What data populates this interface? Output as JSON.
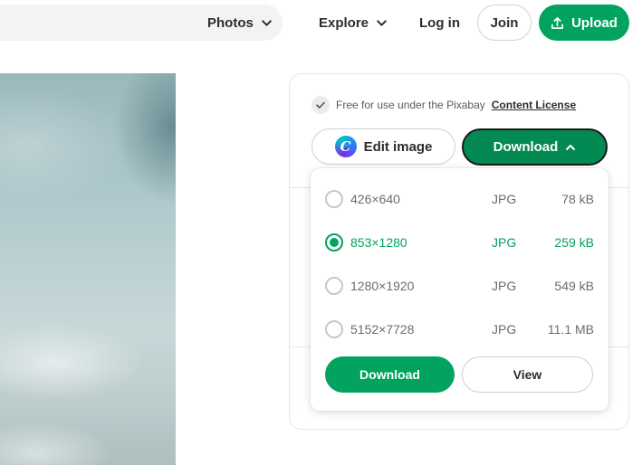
{
  "header": {
    "category_select": "Photos",
    "explore_label": "Explore",
    "login_label": "Log in",
    "join_label": "Join",
    "upload_label": "Upload"
  },
  "panel": {
    "license_text": "Free for use under the Pixabay",
    "license_link": "Content License",
    "edit_image_label": "Edit image",
    "canva_letter": "C",
    "download_label": "Download"
  },
  "dropdown": {
    "sizes": [
      {
        "dimensions": "426×640",
        "format": "JPG",
        "size": "78 kB",
        "selected": false
      },
      {
        "dimensions": "853×1280",
        "format": "JPG",
        "size": "259 kB",
        "selected": true
      },
      {
        "dimensions": "1280×1920",
        "format": "JPG",
        "size": "549 kB",
        "selected": false
      },
      {
        "dimensions": "5152×7728",
        "format": "JPG",
        "size": "11.1 MB",
        "selected": false
      }
    ],
    "download_label": "Download",
    "view_label": "View"
  },
  "colors": {
    "brand_green": "#02a35f",
    "dark_green": "#028a52",
    "text": "#2d2d2d"
  },
  "icons": {
    "category_chevron": "chevron-down-icon",
    "explore_chevron": "chevron-down-icon",
    "upload": "upload-icon",
    "license_check": "checkmark-icon",
    "canva": "canva-icon",
    "download_chevron": "chevron-up-icon"
  }
}
